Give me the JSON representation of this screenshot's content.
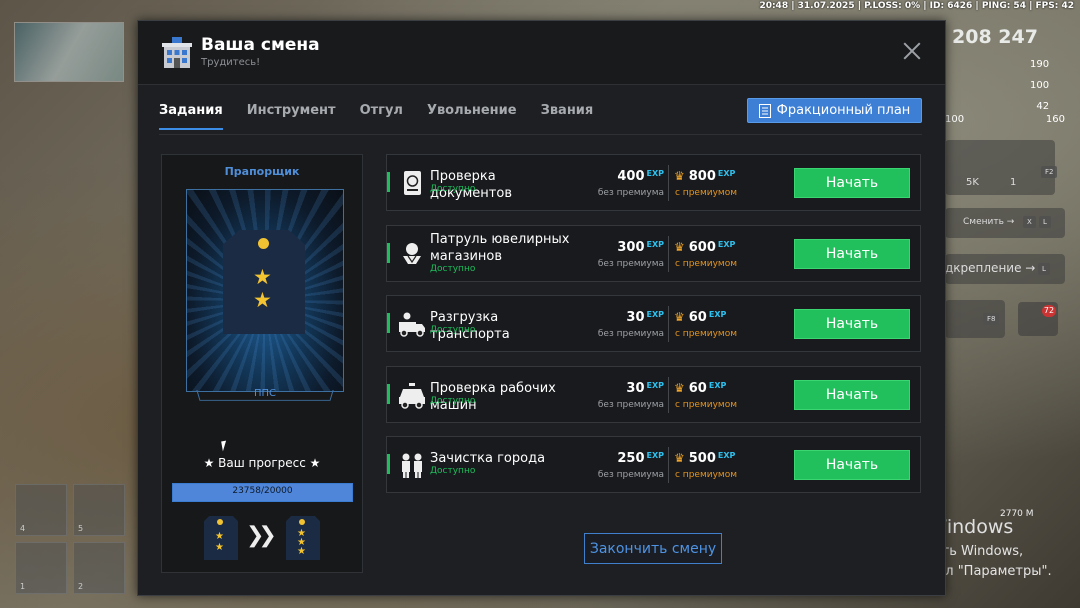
{
  "hud": {
    "topbar": "20:48 | 31.07.2025 | P.LOSS: 0% | ID: 6426 | PING: 54 | FPS: 42",
    "money": "208 247",
    "stats": [
      "190",
      "100",
      "42",
      "160"
    ],
    "mini_left": "100",
    "money_items": [
      "5K",
      "1"
    ],
    "f2": "F2",
    "switch_label": "Сменить →",
    "switch_keys": [
      "X",
      "L"
    ],
    "reinforce_label": "дкрепление →",
    "reinforce_key": "L",
    "f8": "F8",
    "notifications": "72",
    "distance": "2770 M",
    "inv_slots": [
      "4",
      "5",
      "1",
      "2"
    ]
  },
  "windows_activation": {
    "title": "Активация Windows",
    "line1": "Чтобы активировать Windows,",
    "line2": "перейдите в раздел \"Параметры\"."
  },
  "modal": {
    "title": "Ваша смена",
    "subtitle": "Трудитесь!",
    "tabs": [
      "Задания",
      "Инструмент",
      "Отгул",
      "Увольнение",
      "Звания"
    ],
    "active_tab": 0,
    "plan_button": "Фракционный план",
    "end_button": "Закончить смену"
  },
  "rank": {
    "name": "Прапорщик",
    "unit": "ППС",
    "progress_label": "★ Ваш прогресс ★",
    "progress_text": "23758/20000",
    "progress_fraction": 1.0
  },
  "exp_suffix": "EXP",
  "task_labels": {
    "without_premium": "без премиума",
    "with_premium": "с премиумом",
    "start": "Начать"
  },
  "tasks": [
    {
      "name": "Проверка документов",
      "status": "Доступно",
      "exp": "400",
      "exp_premium": "800",
      "icon": "passport-icon"
    },
    {
      "name": "Патруль ювелирных магазинов",
      "status": "Доступно",
      "exp": "300",
      "exp_premium": "600",
      "icon": "jewel-icon"
    },
    {
      "name": "Разгрузка транспорта",
      "status": "Доступно",
      "exp": "30",
      "exp_premium": "60",
      "icon": "truck-icon"
    },
    {
      "name": "Проверка рабочих машин",
      "status": "Доступно",
      "exp": "30",
      "exp_premium": "60",
      "icon": "police-car-icon"
    },
    {
      "name": "Зачистка города",
      "status": "Доступно",
      "exp": "250",
      "exp_premium": "500",
      "icon": "officers-icon"
    }
  ]
}
